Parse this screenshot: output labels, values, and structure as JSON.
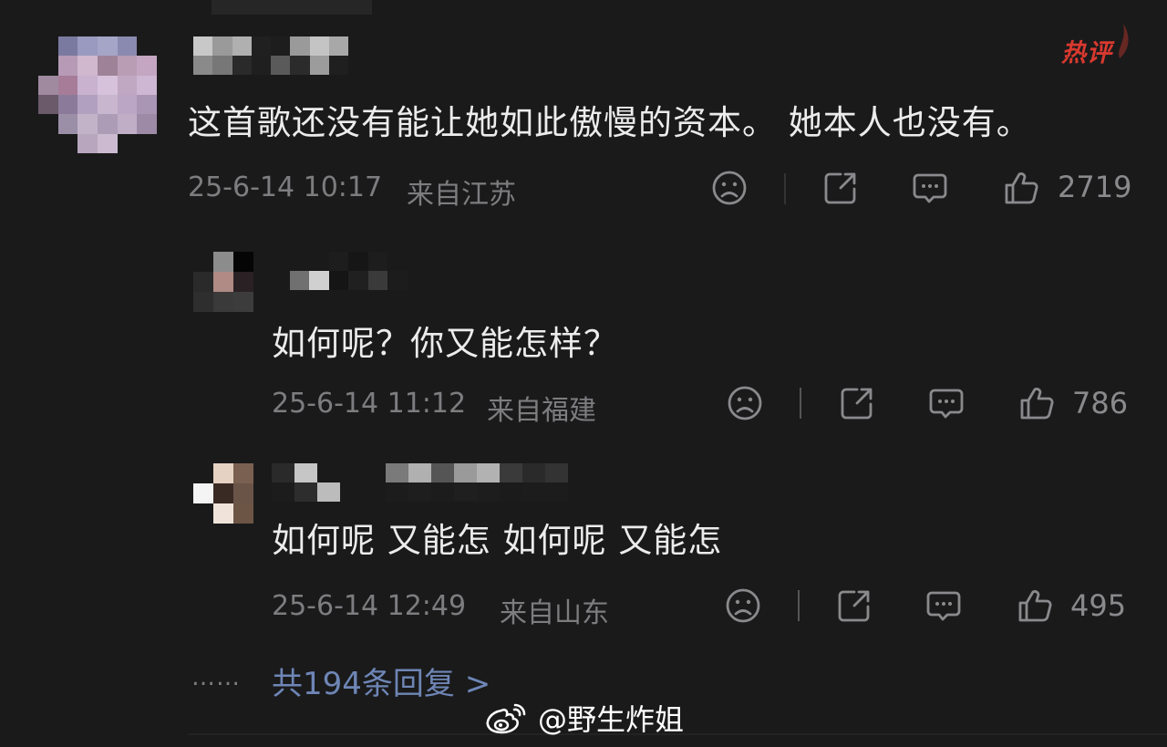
{
  "hot_badge": "热评",
  "main_comment": {
    "text": "这首歌还没有能让她如此傲慢的资本。 她本人也没有。",
    "timestamp": "25-6-14 10:17",
    "location": "来自江苏",
    "likes": "2719"
  },
  "replies": [
    {
      "text": "如何呢？你又能怎样？",
      "timestamp": "25-6-14 11:12",
      "location": "来自福建",
      "likes": "786"
    },
    {
      "text": "如何呢 又能怎 如何呢 又能怎",
      "timestamp": "25-6-14 12:49",
      "location": "来自山东",
      "likes": "495"
    }
  ],
  "more": {
    "dots": "……",
    "label": "共194条回复 >"
  },
  "watermark": {
    "text": "@野生炸姐",
    "icon": "weibo-icon"
  },
  "icons": {
    "dislike": "sad-face-icon",
    "share": "share-icon",
    "comment": "comment-icon",
    "like": "thumbs-up-icon"
  },
  "colors": {
    "background": "#1a1a1b",
    "hot_badge": "#d8392f",
    "link": "#6e86b6",
    "meta": "#7d7d80"
  }
}
